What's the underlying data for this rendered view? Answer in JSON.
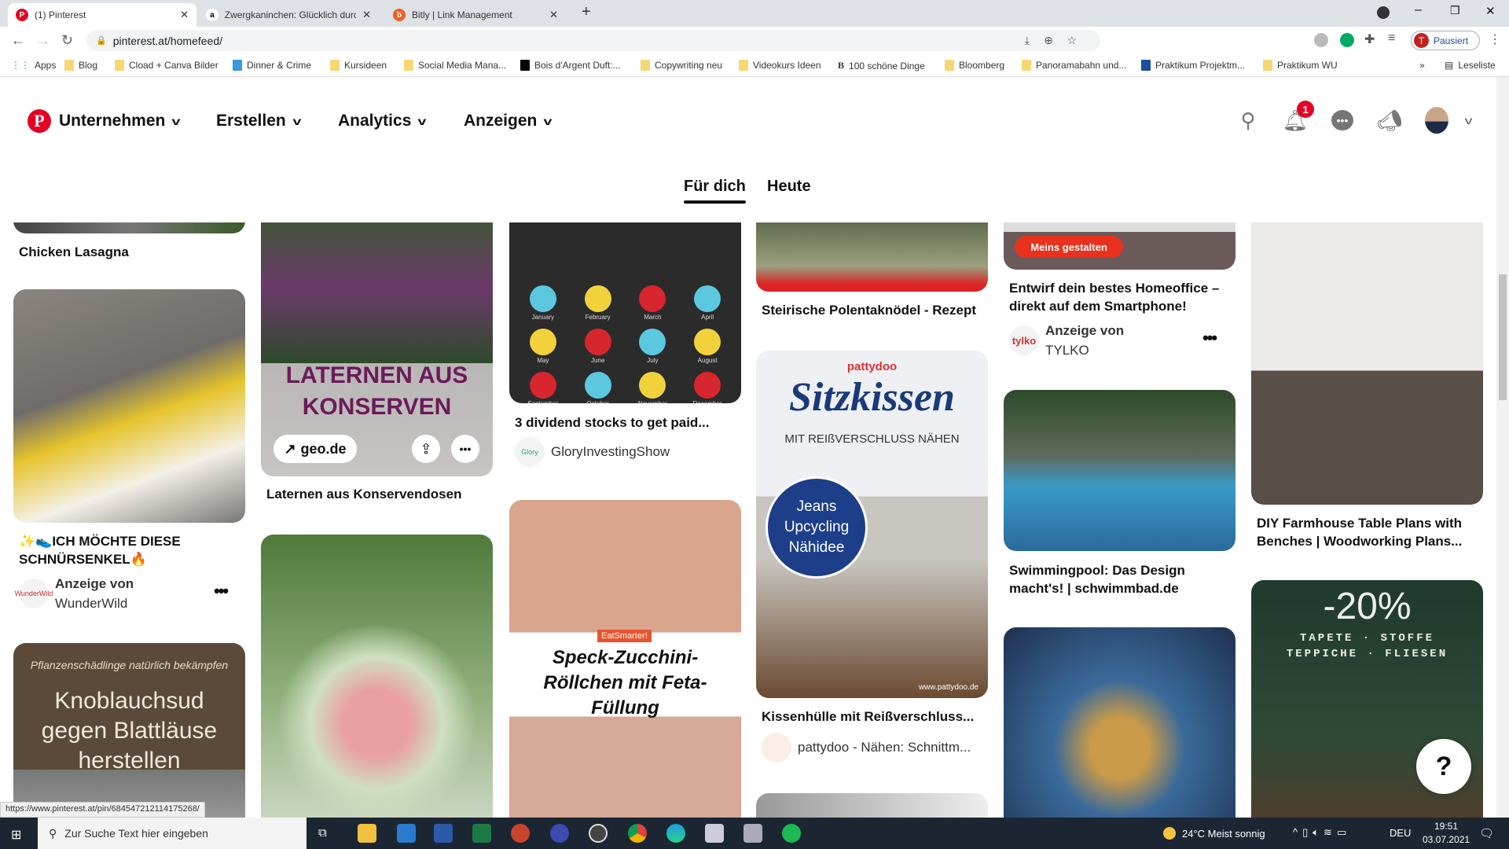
{
  "browser": {
    "tabs": [
      {
        "title": "(1) Pinterest",
        "active": true
      },
      {
        "title": "Zwergkaninchen: Glücklich durch"
      },
      {
        "title": "Bitly | Link Management"
      }
    ],
    "new_tab": "+",
    "url": "pinterest.at/homefeed/",
    "profile_label": "Pausiert",
    "profile_initial": "T",
    "bookmarks": [
      "Apps",
      "Blog",
      "Cload + Canva Bilder",
      "Dinner & Crime",
      "Kursideen",
      "Social Media Mana...",
      "Bois d'Argent Duft:...",
      "Copywriting neu",
      "Videokurs Ideen",
      "100 schöne Dinge",
      "Bloomberg",
      "Panoramabahn und...",
      "Praktikum Projektm...",
      "Praktikum WU"
    ],
    "reading_list": "Leseliste",
    "status_url": "https://www.pinterest.at/pin/684547212114175268/"
  },
  "header": {
    "nav": [
      "Unternehmen",
      "Erstellen",
      "Analytics",
      "Anzeigen"
    ],
    "notification_count": "1",
    "feed_tabs": [
      "Für dich",
      "Heute"
    ],
    "brand_color": "#e60023"
  },
  "feed": {
    "c1": {
      "t1": "Chicken Lasagna",
      "t2": "✨👟ICH MÖCHTE DIESE SCHNÜRSENKEL🔥",
      "ad": "Anzeige von",
      "adv": "WunderWild",
      "img3a": "Pflanzenschädlinge natürlich bekämpfen",
      "img3b": "Knoblauchsud gegen Blattläuse herstellen"
    },
    "c2": {
      "img1": "LATERNEN AUS KONSERVEN",
      "link": "geo.de",
      "t1": "Laternen aus Konservendosen"
    },
    "c3": {
      "t1": "3 dividend stocks to get paid...",
      "creator": "GloryInvestingShow",
      "img2tag": "EatSmarter!",
      "img2": "Speck-Zucchini-Röllchen mit Feta-Füllung",
      "months": [
        "January",
        "February",
        "March",
        "April",
        "May",
        "June",
        "July",
        "August",
        "September",
        "October",
        "November",
        "December"
      ]
    },
    "c4": {
      "t1": "Steirische Polentaknödel - Rezept",
      "brand": "pattydoo",
      "img2a": "Sitzkissen",
      "img2b": "MIT REIßVERSCHLUSS NÄHEN",
      "img2c": "Jeans Upcycling Nähidee",
      "img2d": "www.pattydoo.de",
      "t2": "Kissenhülle mit Reißverschluss...",
      "creator": "pattydoo - Nähen: Schnittm..."
    },
    "c5": {
      "cta": "Meins gestalten",
      "t1": "Entwirf dein bestes Homeoffice – direkt auf dem Smartphone!",
      "ad": "Anzeige von",
      "adv": "TYLKO",
      "logo": "tylko",
      "t2": "Swimmingpool: Das Design macht's! | schwimmbad.de"
    },
    "c6": {
      "t1": "DIY Farmhouse Table Plans with Benches | Woodworking Plans...",
      "img2a": "-20%",
      "img2b": "TAPETE · STOFFE",
      "img2c": "TEPPICHE · FLIESEN"
    }
  },
  "help": "?",
  "taskbar": {
    "search_placeholder": "Zur Suche Text hier eingeben",
    "weather": "24°C  Meist sonnig",
    "lang": "DEU",
    "time": "19:51",
    "date": "03.07.2021"
  }
}
